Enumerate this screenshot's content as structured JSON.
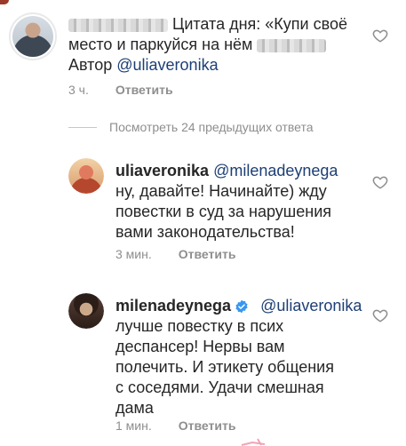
{
  "comments": [
    {
      "username_redacted": true,
      "text_line1": "Цитата дня: «Купи своё",
      "text_line2": "место и паркуйся на нём",
      "text_line3_prefix": "Автор ",
      "text_line3_mention": "@uliaveronika",
      "time": "3 ч.",
      "reply_label": "Ответить"
    }
  ],
  "view_replies_label": "Посмотреть 24 предыдущих ответа",
  "replies": [
    {
      "username": "uliaveronika",
      "mention": "@milenadeynega",
      "lines": [
        "ну, давайте! Начинайте) жду",
        "повестки в суд за нарушения",
        "вами законодательства!"
      ],
      "time": "3 мин.",
      "reply_label": "Ответить"
    },
    {
      "username": "milenadeynega",
      "verified": true,
      "mention": "@uliaveronika",
      "lines": [
        "лучше повестку в псих",
        "деспансер! Нервы вам",
        "полечить. И этикету общения",
        "с соседями.  Удачи смешная",
        "дама"
      ],
      "time": "1 мин.",
      "reply_label": "Ответить"
    }
  ],
  "icons": {
    "like": "heart-outline-icon",
    "verified": "verified-badge-icon"
  },
  "colors": {
    "mention": "#1d3f75",
    "meta": "#8e8e8e",
    "verified": "#3897f0"
  }
}
